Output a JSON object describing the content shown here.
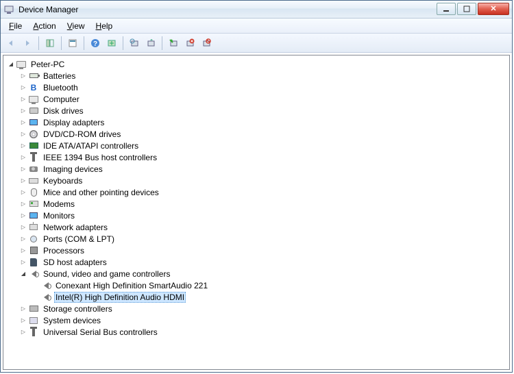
{
  "window": {
    "title": "Device Manager"
  },
  "menu": {
    "file": "File",
    "action": "Action",
    "view": "View",
    "help": "Help"
  },
  "root": "Peter-PC",
  "categories": [
    {
      "label": "Batteries",
      "icon": "batt"
    },
    {
      "label": "Bluetooth",
      "icon": "bt"
    },
    {
      "label": "Computer",
      "icon": "pc"
    },
    {
      "label": "Disk drives",
      "icon": "disk"
    },
    {
      "label": "Display adapters",
      "icon": "monitor"
    },
    {
      "label": "DVD/CD-ROM drives",
      "icon": "cd"
    },
    {
      "label": "IDE ATA/ATAPI controllers",
      "icon": "card"
    },
    {
      "label": "IEEE 1394 Bus host controllers",
      "icon": "usb"
    },
    {
      "label": "Imaging devices",
      "icon": "cam"
    },
    {
      "label": "Keyboards",
      "icon": "kb"
    },
    {
      "label": "Mice and other pointing devices",
      "icon": "mouse"
    },
    {
      "label": "Modems",
      "icon": "modem"
    },
    {
      "label": "Monitors",
      "icon": "monitor"
    },
    {
      "label": "Network adapters",
      "icon": "net"
    },
    {
      "label": "Ports (COM & LPT)",
      "icon": "port"
    },
    {
      "label": "Processors",
      "icon": "cpu"
    },
    {
      "label": "SD host adapters",
      "icon": "sd"
    },
    {
      "label": "Sound, video and game controllers",
      "icon": "snd",
      "expanded": true,
      "children": [
        {
          "label": "Conexant High Definition SmartAudio 221",
          "icon": "snd"
        },
        {
          "label": "Intel(R) High Definition Audio HDMI",
          "icon": "snd",
          "selected": true
        }
      ]
    },
    {
      "label": "Storage controllers",
      "icon": "stor"
    },
    {
      "label": "System devices",
      "icon": "sys"
    },
    {
      "label": "Universal Serial Bus controllers",
      "icon": "usb"
    }
  ]
}
